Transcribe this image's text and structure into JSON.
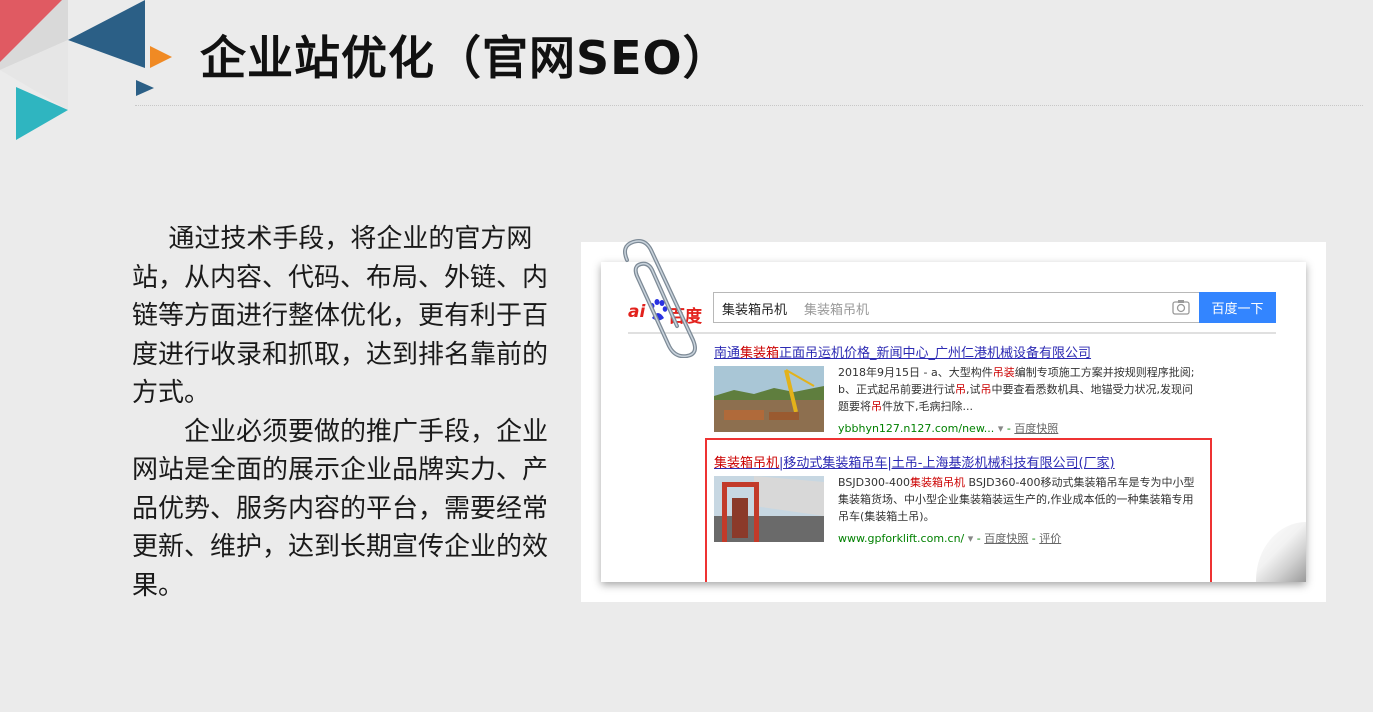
{
  "slide": {
    "title": "企业站优化（官网SEO）",
    "paragraphs": [
      "通过技术手段，将企业的官方网站，从内容、代码、布局、外链、内链等方面进行整体优化，更有利于百度进行收录和抓取，达到排名靠前的方式。",
      "企业必须要做的推广手段，企业网站是全面的展示企业品牌实力、产品优势、服务内容的平台，需要经常更新、维护，达到长期宣传企业的效果。"
    ],
    "colors": {
      "triangle_red": "#e05a62",
      "triangle_blue": "#2b5f86",
      "triangle_teal": "#2fb5c0",
      "triangle_orange": "#f08a24",
      "triangle_gray": "#d9d9d9"
    }
  },
  "baidu": {
    "logo_ai": "ai",
    "logo_du": "百度",
    "query": "集装箱吊机",
    "placeholder": "集装箱吊机",
    "search_button": "百度一下",
    "accent": "#3385ff",
    "results": [
      {
        "title_pre": "南通",
        "title_hl": "集装箱",
        "title_post": "正面吊运机价格_新闻中心_广州仁港机械设备有限公司",
        "abstract": [
          {
            "t": "2018年9月15日 - a、大型构件",
            "hl": false
          },
          {
            "t": "吊装",
            "hl": true
          },
          {
            "t": "编制专项施工方案并按规则程序批阅; b、正式起吊前要进行试",
            "hl": false
          },
          {
            "t": "吊",
            "hl": true
          },
          {
            "t": ",试",
            "hl": false
          },
          {
            "t": "吊",
            "hl": true
          },
          {
            "t": "中要查看悉数机具、地锚受力状况,发现问题要将",
            "hl": false
          },
          {
            "t": "吊",
            "hl": true
          },
          {
            "t": "件放下,毛病扫除...",
            "hl": false
          }
        ],
        "url": "ybbhyn127.n127.com/new...",
        "snapshot": "百度快照"
      },
      {
        "title_hl": "集装箱吊机",
        "title_post": "|移动式集装箱吊车|土吊-上海基澎机械科技有限公司(厂家)",
        "abstract": [
          {
            "t": "BSJD300-400",
            "hl": false
          },
          {
            "t": "集装箱吊机",
            "hl": true
          },
          {
            "t": " BSJD360-400移动式集装箱吊车是专为中小型集装箱货场、中小型企业集装箱装运生产的,作业成本低的一种集装箱专用吊车(集装箱土吊)。",
            "hl": false
          }
        ],
        "url": "www.gpforklift.com.cn/",
        "snapshot": "百度快照",
        "review": "评价"
      }
    ]
  }
}
